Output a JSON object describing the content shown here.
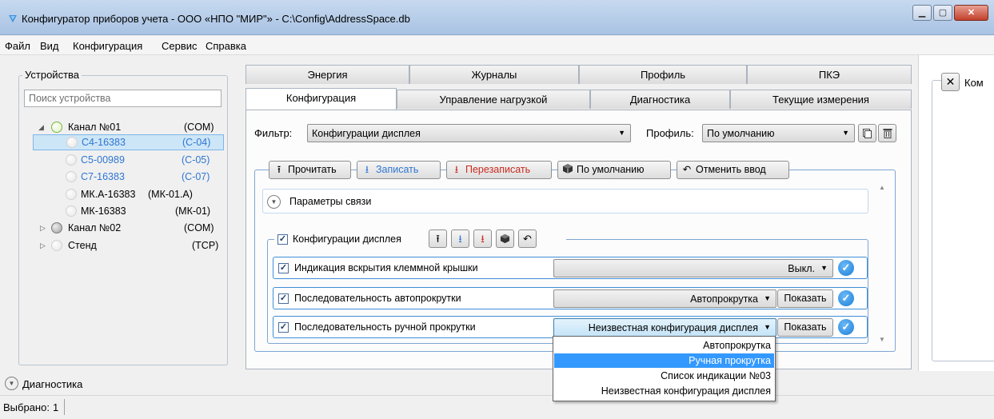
{
  "window": {
    "title": "Конфигуратор приборов учета - ООО «НПО \"МИР\"» - C:\\Config\\AddressSpace.db",
    "minimize": "▁",
    "maximize": "▢",
    "close": "✕"
  },
  "menu": [
    "Файл",
    "Вид",
    "Конфигурация",
    "Сервис",
    "Справка"
  ],
  "devices": {
    "title": "Устройства",
    "search_placeholder": "Поиск устройства",
    "tree": [
      {
        "label": "Канал №01",
        "type": "(COM)",
        "state": "expanded",
        "status_color": "#e2f3cc"
      },
      {
        "label": "С4-16383",
        "type": "(С-04)",
        "selected": true,
        "text_color": "#2e76d3"
      },
      {
        "label": "С5-00989",
        "type": "(С-05)",
        "text_color": "#2e76d3"
      },
      {
        "label": "С7-16383",
        "type": "(С-07)",
        "text_color": "#2e76d3"
      },
      {
        "label": "МК.А-16383",
        "type": "(МК-01.А)"
      },
      {
        "label": "МК-16383",
        "type": "(МК-01)"
      },
      {
        "label": "Канал №02",
        "type": "(COM)",
        "state": "collapsed"
      },
      {
        "label": "Стенд",
        "type": "(TCP)",
        "state": "collapsed"
      }
    ]
  },
  "tabs_row1": [
    "Энергия",
    "Журналы",
    "Профиль",
    "ПКЭ"
  ],
  "tabs_row2": [
    "Конфигурация",
    "Управление нагрузкой",
    "Диагностика",
    "Текущие измерения"
  ],
  "filter": {
    "label": "Фильтр:",
    "value": "Конфигурации дисплея"
  },
  "profile": {
    "label": "Профиль:",
    "value": "По умолчанию"
  },
  "toolbar": {
    "read": "Прочитать",
    "write": "Записать",
    "rewrite": "Перезаписать",
    "default": "По умолчанию",
    "cancel": "Отменить ввод"
  },
  "connection_params": "Параметры связи",
  "display_group": {
    "label": "Конфигурации дисплея",
    "checked": true
  },
  "params": [
    {
      "name": "Индикация вскрытия клеммной крышки",
      "value": "Выкл.",
      "checked": true
    },
    {
      "name": "Последовательность автопрокрутки",
      "value": "Автопрокрутка",
      "button": "Показать",
      "checked": true
    },
    {
      "name": "Последовательность ручной прокрутки",
      "value": "Неизвестная конфигурация дисплея",
      "button": "Показать",
      "checked": true
    }
  ],
  "dropdown_options": [
    "Автопрокрутка",
    "Ручная прокрутка",
    "Список индикации №03",
    "Неизвестная конфигурация дисплея"
  ],
  "dropdown_selected_index": 1,
  "right_panel": {
    "close": "✕",
    "label": "Ком"
  },
  "diagnostics": "Диагностика",
  "status": {
    "label": "Выбрано:",
    "value": "1"
  }
}
